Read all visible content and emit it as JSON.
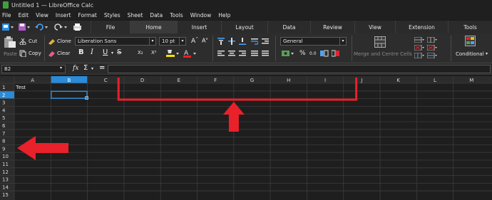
{
  "window": {
    "title": "Untitled 1 — LibreOffice Calc"
  },
  "menu": [
    "File",
    "Edit",
    "View",
    "Insert",
    "Format",
    "Styles",
    "Sheet",
    "Data",
    "Tools",
    "Window",
    "Help"
  ],
  "tabs": [
    "File",
    "Home",
    "Insert",
    "Layout",
    "Data",
    "Review",
    "View",
    "Extension",
    "Tools"
  ],
  "active_tab": "Home",
  "ribbon": {
    "cut": "Cut",
    "copy": "Copy",
    "paste": "Paste",
    "clone": "Clone",
    "clear": "Clear",
    "font_name": "Liberation Sans",
    "font_size": "10 pt",
    "number_format": "General",
    "merge_label": "Merge and Centre Cells",
    "conditional_label": "Conditional",
    "bold": "B",
    "italic": "I",
    "underline": "U",
    "strike": "S",
    "superscript": "X²",
    "subscript": "X₂",
    "percent": "%",
    "decimal": "0.0"
  },
  "formula": {
    "cell_ref": "B2",
    "fx": "fx",
    "sigma": "Σ",
    "equals": "="
  },
  "sheet": {
    "columns": [
      "A",
      "B",
      "C",
      "D",
      "E",
      "F",
      "G",
      "H",
      "I",
      "J",
      "K",
      "L",
      "M"
    ],
    "rows": [
      "1",
      "2",
      "3",
      "4",
      "5",
      "6",
      "7",
      "8",
      "9",
      "10",
      "11",
      "12",
      "13",
      "14",
      "15"
    ],
    "selected_column": "B",
    "selected_row": "2",
    "cells": {
      "A1": "Test"
    }
  },
  "colors": {
    "accent": "#1e90ff",
    "annotation": "#e8212a",
    "selection_header": "#2a8bd8"
  },
  "icons": [
    "new-document-icon",
    "save-icon",
    "undo-icon",
    "redo-icon",
    "print-icon",
    "cut-icon",
    "copy-icon",
    "paste-icon",
    "clone-icon",
    "clear-icon",
    "bold-icon",
    "italic-icon",
    "underline-icon",
    "strikethrough-icon",
    "highlight-icon",
    "font-color-icon",
    "align-top-icon",
    "align-middle-icon",
    "align-bottom-icon",
    "align-left-icon",
    "align-center-icon",
    "align-right-icon",
    "justify-icon",
    "wrap-icon",
    "currency-icon",
    "percent-icon",
    "merge-cells-icon",
    "conditional-format-icon",
    "function-wizard-icon",
    "sum-icon",
    "red-arrow-up",
    "red-arrow-left"
  ]
}
